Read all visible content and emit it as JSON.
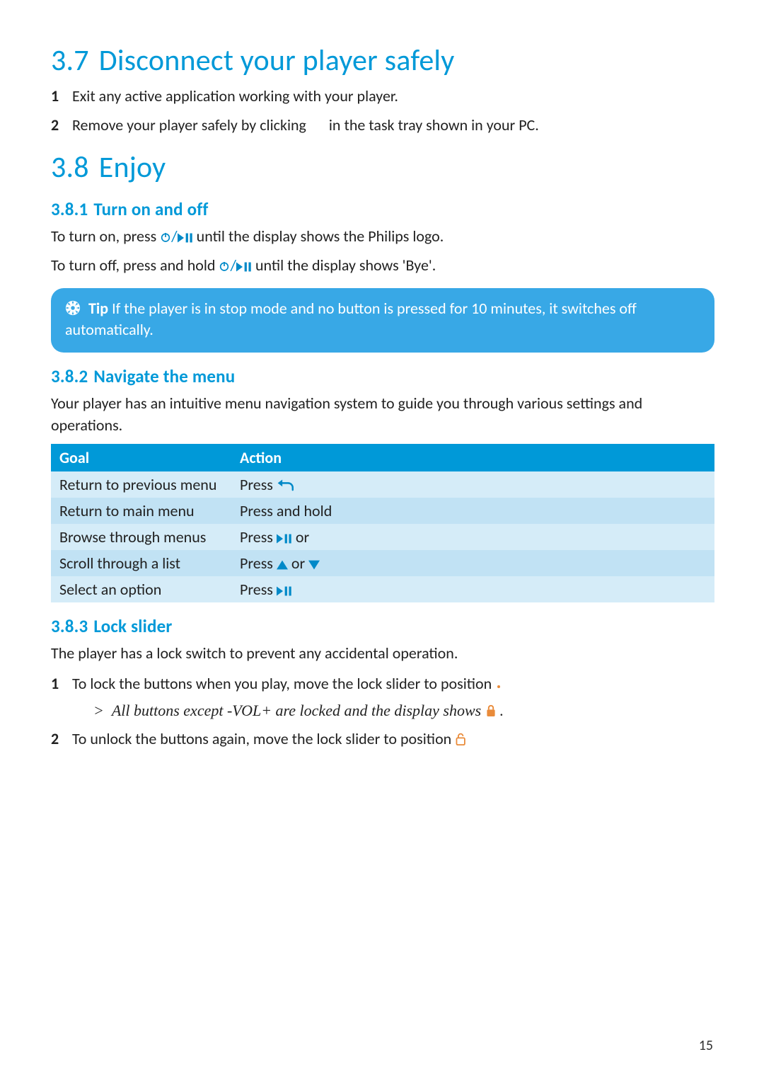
{
  "colors": {
    "accent": "#0099d8",
    "tip_bg": "#38a8e6"
  },
  "page_number": "15",
  "s37": {
    "num": "3.7",
    "title": "Disconnect your player safely",
    "step1": "Exit any active application working with your player.",
    "step2a": "Remove your player safely by clicking ",
    "step2b": " in the task tray shown in your PC."
  },
  "s38": {
    "num": "3.8",
    "title": "Enjoy",
    "s381": {
      "num": "3.8.1",
      "title": "Turn on and off",
      "p1a": "To turn on, press ",
      "p1b": " until the display shows the Philips logo.",
      "p2a": "To turn off, press and hold ",
      "p2b": " until the display shows 'Bye'."
    },
    "tip": {
      "label": "Tip",
      "text": " If the player is in stop mode and no button is pressed for 10 minutes, it switches off automatically."
    },
    "s382": {
      "num": "3.8.2",
      "title": "Navigate the menu",
      "intro": "Your player has an intuitive menu navigation system to guide you through various settings and operations.",
      "headers": {
        "goal": "Goal",
        "action": "Action"
      },
      "rows": [
        {
          "goal": "Return to previous menu",
          "action_pre": "Press ",
          "icon": "back",
          "action_post": ""
        },
        {
          "goal": "Return to main menu",
          "action_pre": "Press and hold",
          "icon": "",
          "action_post": ""
        },
        {
          "goal": "Browse through menus",
          "action_pre": "Press ",
          "icon": "playpause",
          "action_post": " or"
        },
        {
          "goal": "Scroll through a list",
          "action_pre": "Press ",
          "icon": "up",
          "action_post": " or ",
          "icon2": "down"
        },
        {
          "goal": "Select an option",
          "action_pre": "Press ",
          "icon": "playpause",
          "action_post": ""
        }
      ]
    },
    "s383": {
      "num": "3.8.3",
      "title": "Lock slider",
      "intro": "The player has a lock switch to prevent any accidental operation.",
      "step1": "To lock the buttons when you play, move the lock slider to position ",
      "result_gt": ">",
      "result_a": "All buttons except ",
      "result_vol": "-VOL+",
      "result_b": " are locked and the display shows ",
      "result_c": " .",
      "step2": "To unlock the buttons again, move the lock slider to position "
    }
  }
}
